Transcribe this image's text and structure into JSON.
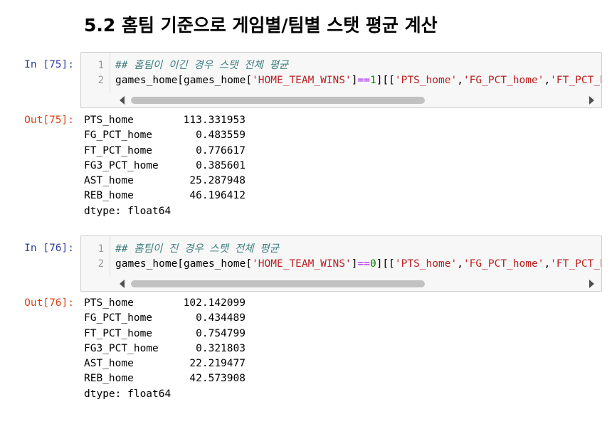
{
  "heading": "5.2  홈팀 기준으로 게임별/팀별 스탯 평균 계산",
  "cells": [
    {
      "in_prompt": "In [75]:",
      "line_numbers": [
        "1",
        "2"
      ],
      "comment": "## 홈팀이 이긴 경우 스탯 전체 평균",
      "code": {
        "p1": "games_home[games_home[",
        "s1": "'HOME_TEAM_WINS'",
        "p2": "]",
        "op": "==",
        "num": "1",
        "p3": "][[",
        "s2": "'PTS_home'",
        "p4": ",",
        "s3": "'FG_PCT_home'",
        "p5": ",",
        "s4": "'FT_PCT_home'"
      },
      "out_prompt": "Out[75]:",
      "output": "PTS_home        113.331953\nFG_PCT_home       0.483559\nFT_PCT_home       0.776617\nFG3_PCT_home      0.385601\nAST_home         25.287948\nREB_home         46.196412\ndtype: float64"
    },
    {
      "in_prompt": "In [76]:",
      "line_numbers": [
        "1",
        "2"
      ],
      "comment": "## 홈팀이 진 경우 스탯 전체 평균",
      "code": {
        "p1": "games_home[games_home[",
        "s1": "'HOME_TEAM_WINS'",
        "p2": "]",
        "op": "==",
        "num": "0",
        "p3": "][[",
        "s2": "'PTS_home'",
        "p4": ",",
        "s3": "'FG_PCT_home'",
        "p5": ",",
        "s4": "'FT_PCT_home'"
      },
      "out_prompt": "Out[76]:",
      "output": "PTS_home        102.142099\nFG_PCT_home       0.434489\nFT_PCT_home       0.754799\nFG3_PCT_home      0.321803\nAST_home         22.219477\nREB_home         42.573908\ndtype: float64"
    }
  ]
}
